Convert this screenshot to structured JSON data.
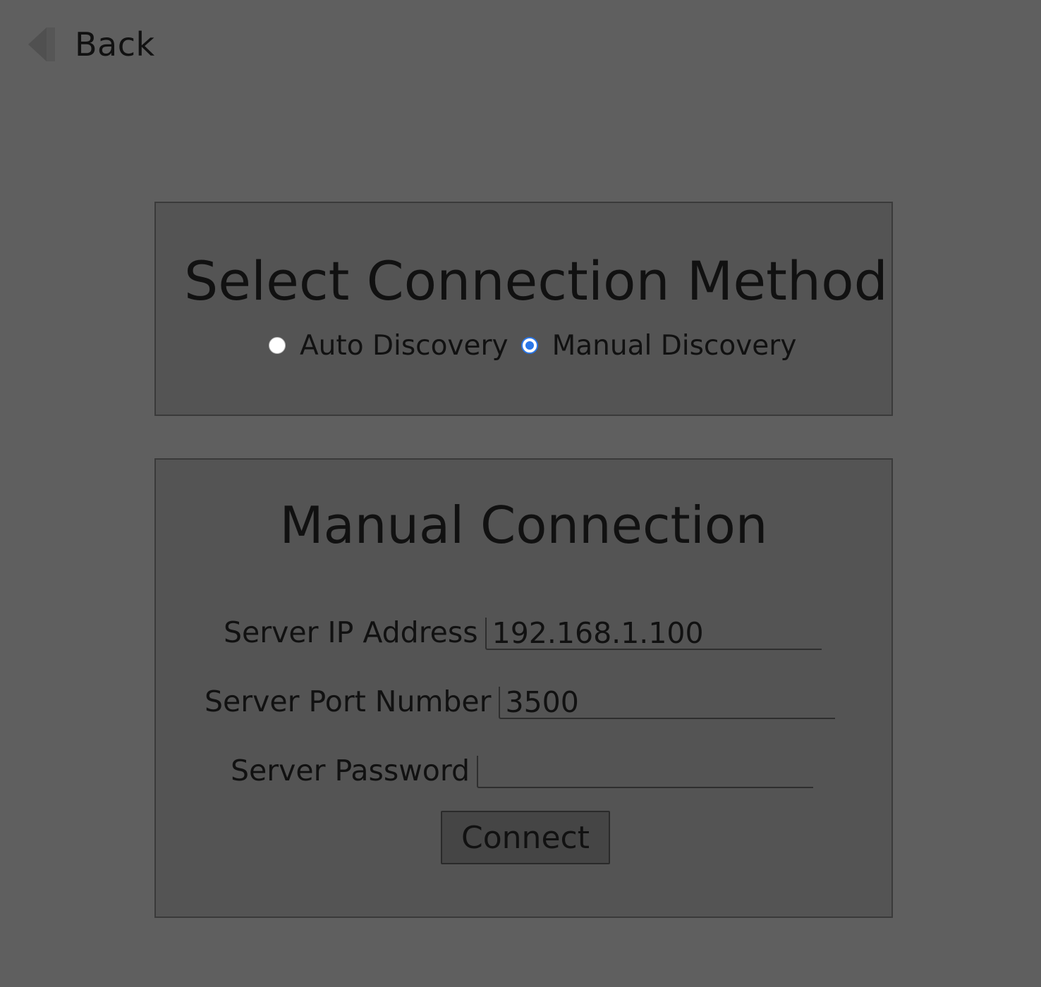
{
  "header": {
    "back_label": "Back",
    "back_icon": "back-arrow-icon"
  },
  "method_panel": {
    "title": "Select Connection Method",
    "options": [
      {
        "label": "Auto Discovery",
        "selected": false
      },
      {
        "label": "Manual Discovery",
        "selected": true
      }
    ]
  },
  "manual_panel": {
    "title": "Manual Connection",
    "fields": {
      "ip": {
        "label": "Server IP Address",
        "value": "192.168.1.100"
      },
      "port": {
        "label": "Server Port Number",
        "value": "3500"
      },
      "password": {
        "label": "Server Password",
        "value": ""
      }
    },
    "connect_label": "Connect"
  },
  "colors": {
    "background": "#5f5f5f",
    "panel": "#545454",
    "accent": "#2a77e8"
  }
}
